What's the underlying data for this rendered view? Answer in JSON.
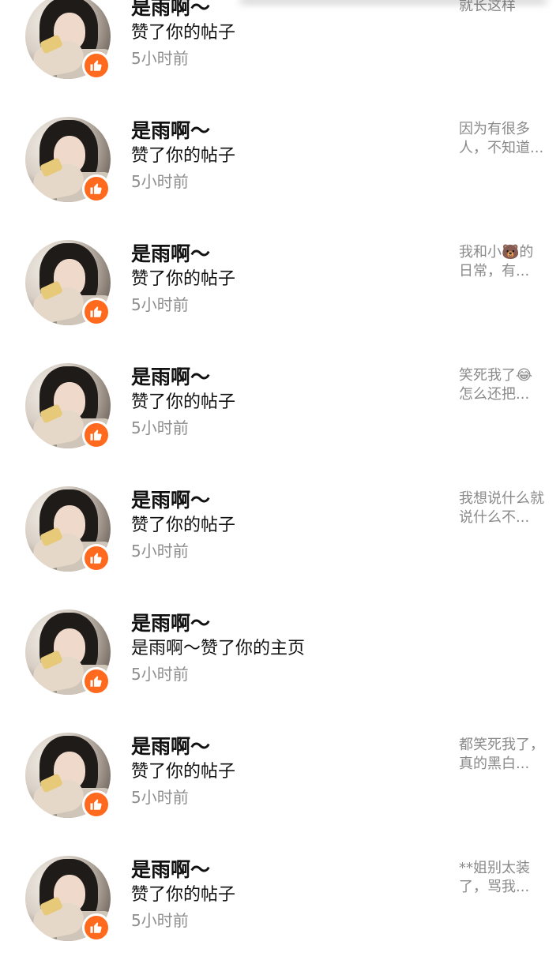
{
  "notifications": [
    {
      "username": "是雨啊～",
      "action": "赞了你的帖子",
      "time": "5小时前",
      "snippet": "就长这样",
      "avatar_icon": "user-avatar",
      "badge_icon": "thumbs-up-icon"
    },
    {
      "username": "是雨啊～",
      "action": "赞了你的帖子",
      "time": "5小时前",
      "snippet": "因为有很多人，不知道...",
      "avatar_icon": "user-avatar",
      "badge_icon": "thumbs-up-icon"
    },
    {
      "username": "是雨啊～",
      "action": "赞了你的帖子",
      "time": "5小时前",
      "snippet": "我和小🐻的日常，有...",
      "avatar_icon": "user-avatar",
      "badge_icon": "thumbs-up-icon"
    },
    {
      "username": "是雨啊～",
      "action": "赞了你的帖子",
      "time": "5小时前",
      "snippet": "笑死我了😂怎么还把...",
      "avatar_icon": "user-avatar",
      "badge_icon": "thumbs-up-icon"
    },
    {
      "username": "是雨啊～",
      "action": "赞了你的帖子",
      "time": "5小时前",
      "snippet": "我想说什么就说什么不...",
      "avatar_icon": "user-avatar",
      "badge_icon": "thumbs-up-icon"
    },
    {
      "username": "是雨啊～",
      "action": "是雨啊～赞了你的主页",
      "time": "5小时前",
      "snippet": "",
      "avatar_icon": "user-avatar",
      "badge_icon": "thumbs-up-icon"
    },
    {
      "username": "是雨啊～",
      "action": "赞了你的帖子",
      "time": "5小时前",
      "snippet": "都笑死我了，真的黑白...",
      "avatar_icon": "user-avatar",
      "badge_icon": "thumbs-up-icon"
    },
    {
      "username": "是雨啊～",
      "action": "赞了你的帖子",
      "time": "5小时前",
      "snippet": "**姐别太装了，骂我...",
      "avatar_icon": "user-avatar",
      "badge_icon": "thumbs-up-icon"
    }
  ],
  "colors": {
    "badge": "#ff6a1f",
    "username": "#111111",
    "time": "#8e8e8e",
    "snippet": "#8a8a8a",
    "top_bar": "#ff3b6a"
  }
}
